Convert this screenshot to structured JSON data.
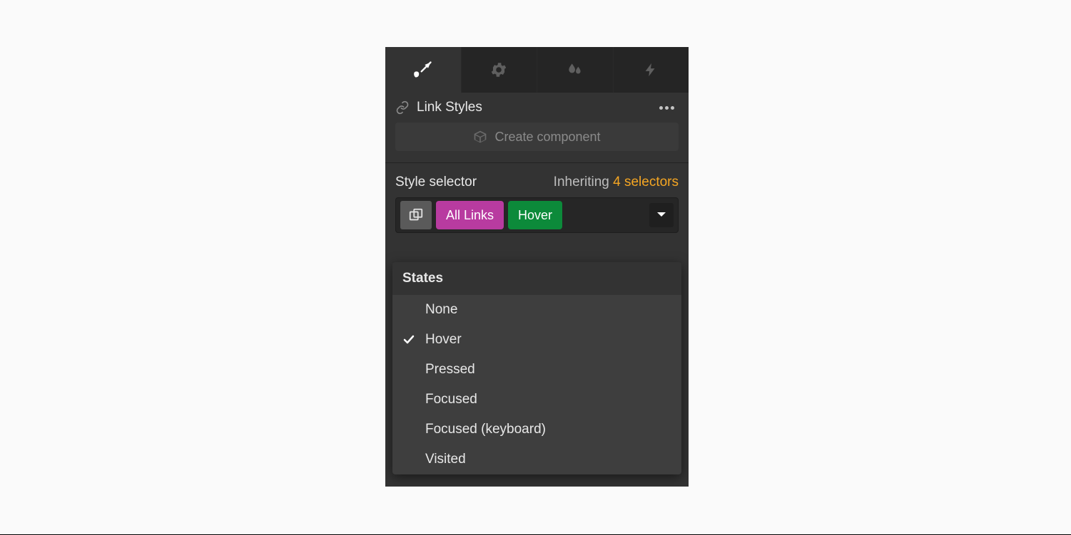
{
  "tabs": {
    "items": [
      {
        "name": "brush-icon",
        "active": true
      },
      {
        "name": "gear-icon",
        "active": false
      },
      {
        "name": "droplets-icon",
        "active": false
      },
      {
        "name": "bolt-icon",
        "active": false
      }
    ]
  },
  "header": {
    "title": "Link Styles",
    "icon": "link-icon"
  },
  "create_component": {
    "label": "Create component",
    "icon": "package-icon"
  },
  "style_selector": {
    "label": "Style selector",
    "inheriting_label": "Inheriting",
    "inheriting_count_text": "4 selectors",
    "chips": [
      {
        "label": "All Links",
        "color": "pink"
      },
      {
        "label": "Hover",
        "color": "green"
      }
    ]
  },
  "states_dropdown": {
    "title": "States",
    "selected": "Hover",
    "items": [
      {
        "label": "None",
        "selected": false
      },
      {
        "label": "Hover",
        "selected": true
      },
      {
        "label": "Pressed",
        "selected": false
      },
      {
        "label": "Focused",
        "selected": false
      },
      {
        "label": "Focused (keyboard)",
        "selected": false
      },
      {
        "label": "Visited",
        "selected": false
      }
    ]
  },
  "colors": {
    "accent_orange": "#f5a623",
    "chip_pink": "#b83ba0",
    "chip_green": "#0c8a3a"
  }
}
